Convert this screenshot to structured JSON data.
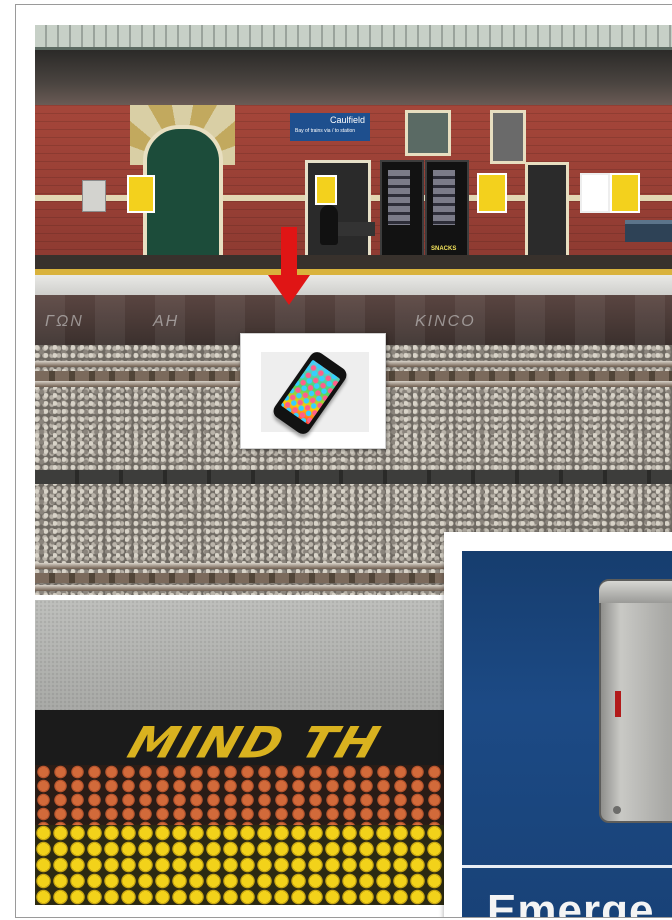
{
  "station_sign": {
    "name": "Caulfield",
    "subtitle": "Bay of trains via / to station"
  },
  "vending": {
    "label": "SNACKS"
  },
  "graffiti": [
    "ΓΩΝ",
    "AH",
    "ΚΙΝCO"
  ],
  "platform_marking": {
    "text": "MIND TH"
  },
  "emergency_sign": {
    "text": "Emerge"
  },
  "colors": {
    "arrow": "#e01515",
    "sign_blue": "#1e4f8e",
    "emergency_panel": "#1c4a85",
    "tactile_yellow": "#f2d21a",
    "tactile_orange": "#d26a3a"
  },
  "icons": {
    "arrow": "down-arrow-icon",
    "phone": "smartphone-icon"
  }
}
